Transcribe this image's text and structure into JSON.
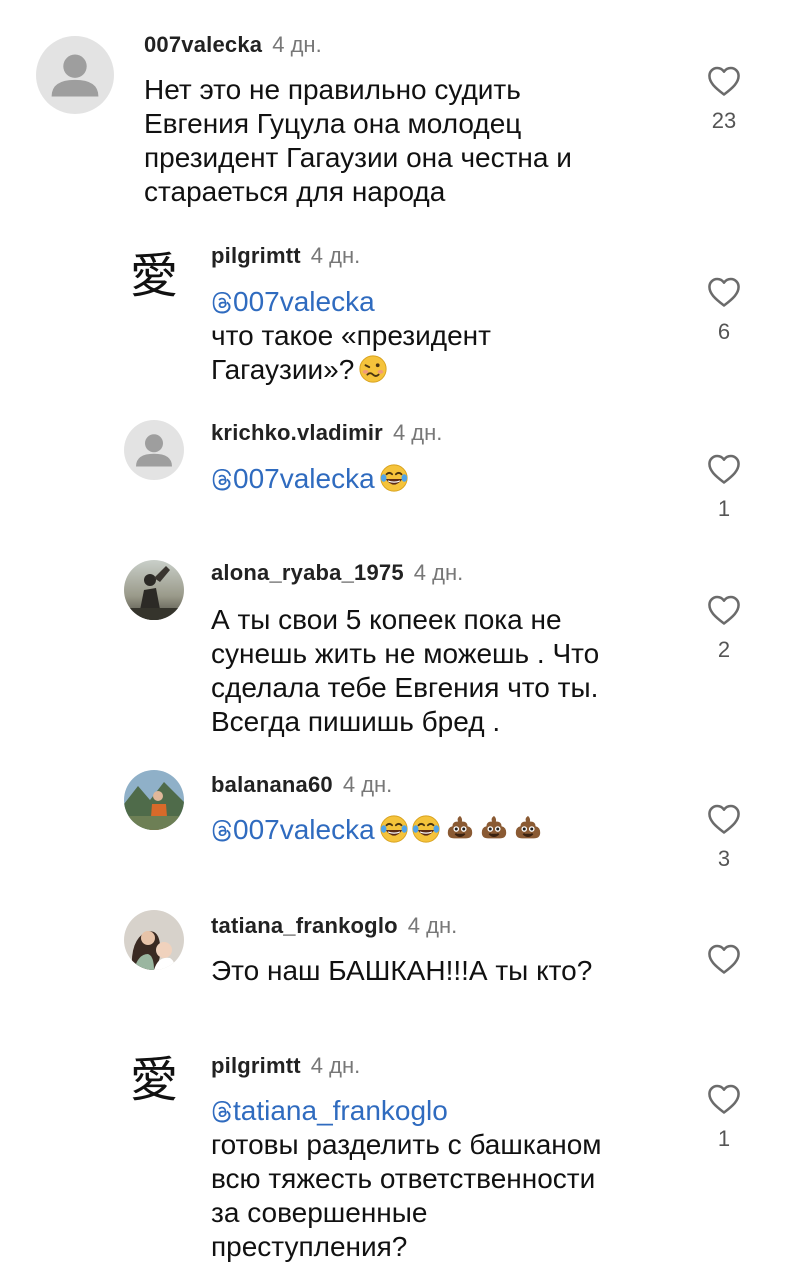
{
  "comments": [
    {
      "username": "007valecka",
      "time": "4 дн.",
      "lines": [
        "Нет это не правильно судить",
        "Евгения Гуцула она молодец",
        "президент Гагаузии она честна и",
        "стараеться для народа"
      ],
      "likes": "23",
      "avatar": "default-avatar"
    },
    {
      "username": "pilgrimtt",
      "time": "4 дн.",
      "mention": "007valecka",
      "lines": [
        "что такое «президент",
        "Гагаузии»?"
      ],
      "likes": "6",
      "avatar": "kanji-ai-avatar",
      "reply": true
    },
    {
      "username": "krichko.vladimir",
      "time": "4 дн.",
      "mention": "007valecka",
      "lines": [],
      "likes": "1",
      "avatar": "default-avatar",
      "reply": true
    },
    {
      "username": "alona_ryaba_1975",
      "time": "4 дн.",
      "lines": [
        "А ты свои 5 копеек пока не",
        "сунешь жить не можешь . Что",
        "сделала тебе  Евгения что ты.",
        "Всегда пишишь бред ."
      ],
      "likes": "2",
      "avatar": "photo-sunset-avatar",
      "reply": true
    },
    {
      "username": "balanana60",
      "time": "4 дн.",
      "mention": "007valecka",
      "lines": [],
      "likes": "3",
      "avatar": "photo-mountains-avatar",
      "reply": true
    },
    {
      "username": "tatiana_frankoglo",
      "time": "4 дн.",
      "lines": [
        "Это наш БАШКАН!!!А ты кто?"
      ],
      "likes": "",
      "avatar": "photo-mother-child-avatar",
      "reply": true
    },
    {
      "username": "pilgrimtt",
      "time": "4 дн.",
      "mention": "tatiana_frankoglo",
      "lines": [
        "готовы разделить с башканом",
        "всю тяжесть ответственности",
        "за совершенные",
        "преступления?"
      ],
      "likes": "1",
      "avatar": "kanji-ai-avatar",
      "reply": true
    }
  ],
  "colors": {
    "mention": "#2f6bbf",
    "username": "#222222",
    "time": "#777777",
    "text": "#111111"
  }
}
